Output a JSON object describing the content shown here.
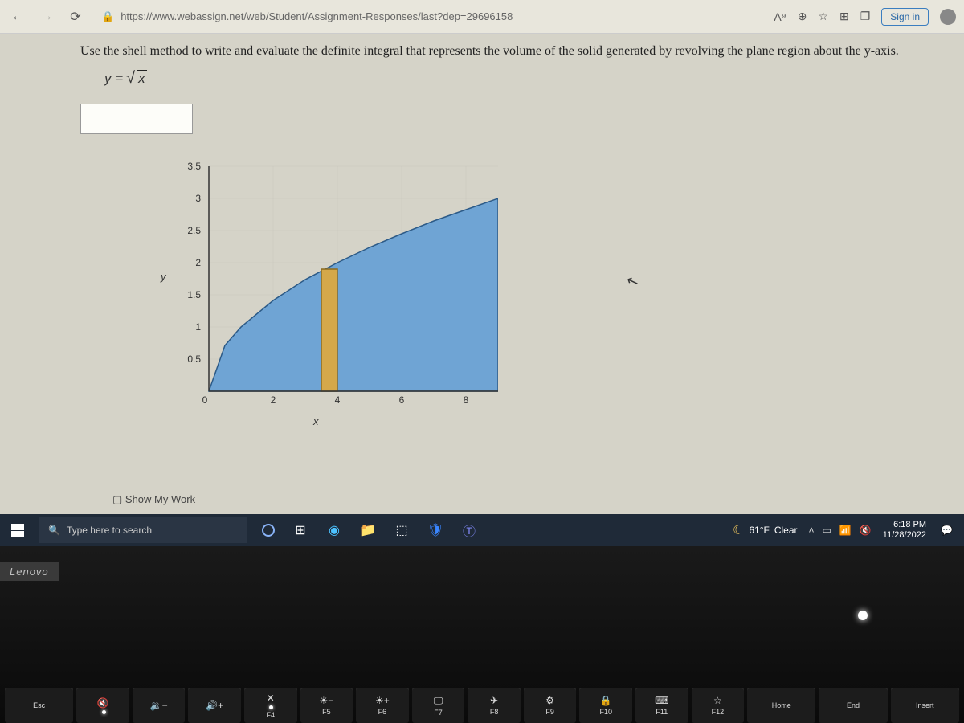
{
  "browser": {
    "url": "https://www.webassign.net/web/Student/Assignment-Responses/last?dep=29696158",
    "sign_in": "Sign in",
    "read_aloud": "A⁹"
  },
  "problem": {
    "text": "Use the shell method to write and evaluate the definite integral that represents the volume of the solid generated by revolving the plane region about the y-axis.",
    "equation_lhs": "y =",
    "equation_under_radical": "x"
  },
  "chart_data": {
    "type": "area",
    "xlabel": "x",
    "ylabel": "y",
    "x_ticks": [
      0,
      2,
      4,
      6,
      8
    ],
    "y_ticks": [
      0,
      0.5,
      1,
      1.5,
      2,
      2.5,
      3,
      3.5
    ],
    "xlim": [
      0,
      9
    ],
    "ylim": [
      0,
      3.5
    ],
    "series": [
      {
        "name": "y = sqrt(x)",
        "x": [
          0,
          0.5,
          1,
          2,
          3,
          4,
          5,
          6,
          7,
          8,
          9
        ],
        "values": [
          0,
          0.707,
          1,
          1.414,
          1.732,
          2,
          2.236,
          2.449,
          2.646,
          2.828,
          3
        ]
      }
    ],
    "shaded_region": {
      "x_start": 0,
      "x_end": 9,
      "bounds": "between y=0 and y=sqrt(x)"
    },
    "shell_highlight": {
      "x_start": 3.5,
      "x_end": 4.0,
      "color": "#d4a84a"
    }
  },
  "show_work": "Show My Work",
  "taskbar": {
    "search_placeholder": "Type here to search",
    "weather_temp": "61°F",
    "weather_cond": "Clear",
    "time": "6:18 PM",
    "date": "11/28/2022"
  },
  "laptop": {
    "brand": "Lenovo",
    "keys": [
      {
        "label": "Esc",
        "icon": "",
        "sub": ""
      },
      {
        "label": "",
        "icon": "🔇",
        "sub": "",
        "led": true
      },
      {
        "label": "",
        "icon": "🔉−",
        "sub": ""
      },
      {
        "label": "",
        "icon": "🔊+",
        "sub": ""
      },
      {
        "label": "F4",
        "icon": "✕",
        "sub": "",
        "led": true
      },
      {
        "label": "F5",
        "icon": "☀−",
        "sub": ""
      },
      {
        "label": "F6",
        "icon": "☀+",
        "sub": ""
      },
      {
        "label": "F7",
        "icon": "🖵",
        "sub": ""
      },
      {
        "label": "F8",
        "icon": "✈",
        "sub": ""
      },
      {
        "label": "F9",
        "icon": "⚙",
        "sub": ""
      },
      {
        "label": "F10",
        "icon": "🔒",
        "sub": ""
      },
      {
        "label": "F11",
        "icon": "⌨",
        "sub": ""
      },
      {
        "label": "F12",
        "icon": "☆",
        "sub": ""
      },
      {
        "label": "Home",
        "icon": "",
        "sub": ""
      },
      {
        "label": "End",
        "icon": "",
        "sub": ""
      },
      {
        "label": "Insert",
        "icon": "",
        "sub": ""
      }
    ]
  }
}
